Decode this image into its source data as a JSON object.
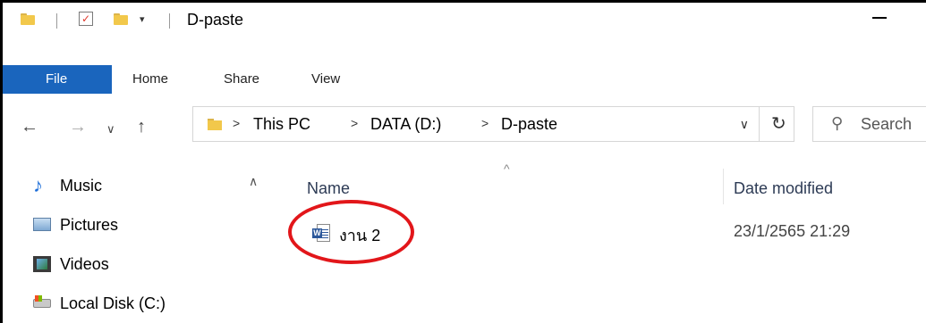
{
  "window": {
    "title": "D-paste"
  },
  "quick_access": {
    "dropdown_glyph": "▾"
  },
  "ribbon": {
    "tabs": [
      "File",
      "Home",
      "Share",
      "View"
    ],
    "active": "File",
    "accent": "#1a65bd"
  },
  "address_bar": {
    "breadcrumbs": [
      "This PC",
      "DATA (D:)",
      "D-paste"
    ],
    "separator": ">",
    "search_placeholder": "Search"
  },
  "sidebar": {
    "items": [
      {
        "label": "Music",
        "icon": "music-icon"
      },
      {
        "label": "Pictures",
        "icon": "pictures-icon"
      },
      {
        "label": "Videos",
        "icon": "videos-icon"
      },
      {
        "label": "Local Disk (C:)",
        "icon": "local-disk-icon"
      }
    ]
  },
  "file_list": {
    "columns": [
      "Name",
      "Date modified"
    ],
    "sort_indicator": "^",
    "rows": [
      {
        "name": "งาน 2",
        "date_modified": "23/1/2565 21:29",
        "icon": "word-document-icon"
      }
    ]
  },
  "annotation": {
    "color": "#e2161a"
  }
}
